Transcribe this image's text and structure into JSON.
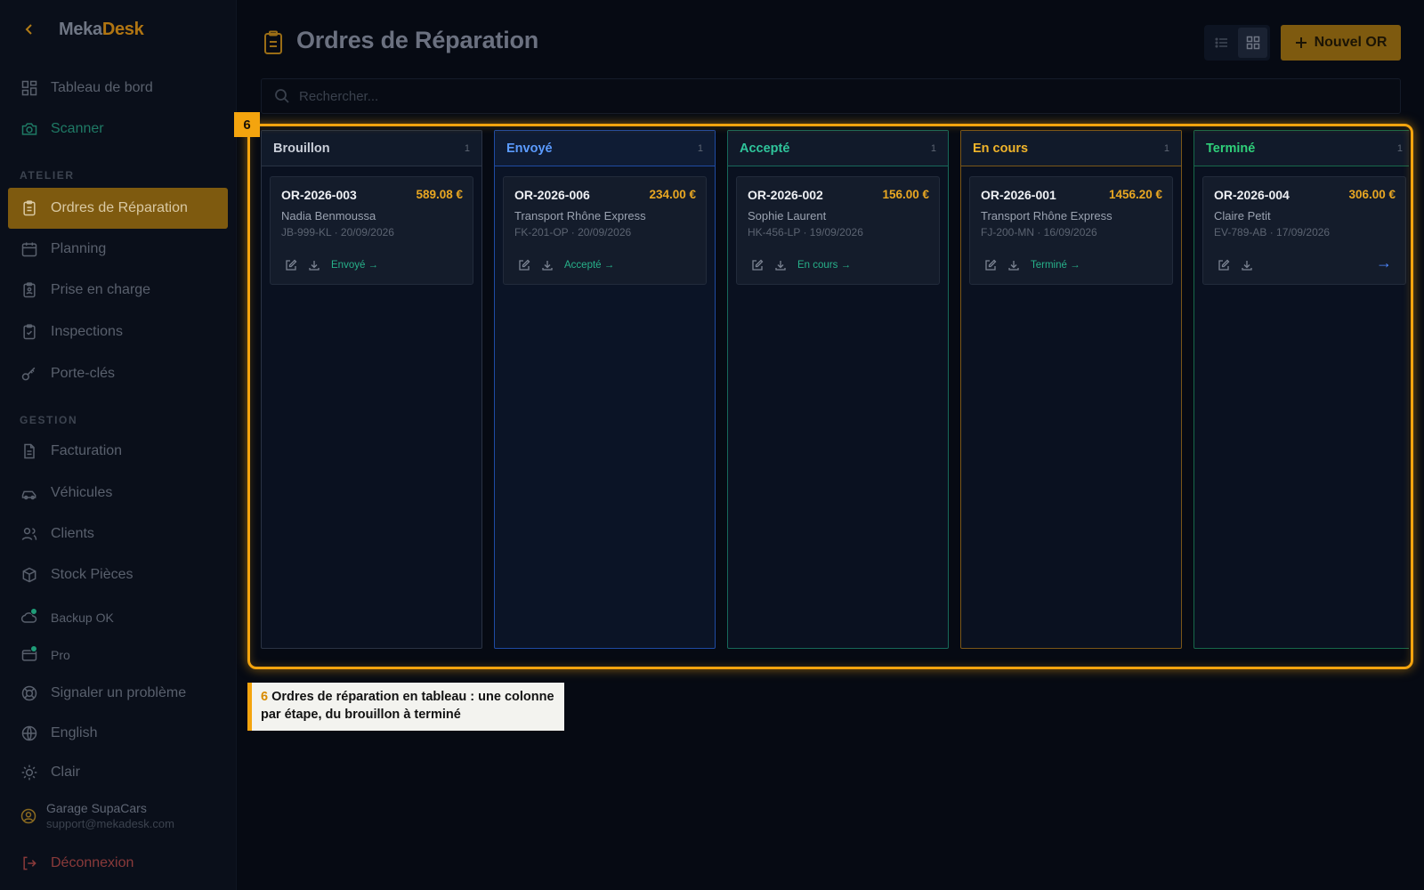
{
  "app": {
    "brand_a": "Meka",
    "brand_b": "Desk",
    "brand_accent": "#b07512"
  },
  "sidebar": {
    "nav": [
      {
        "label": "Tableau de bord",
        "icon": "dashboard-icon"
      },
      {
        "label": "Scanner",
        "icon": "camera-icon"
      }
    ],
    "section_atelier": "ATELIER",
    "atelier": [
      {
        "label": "Ordres de Réparation",
        "icon": "clipboard-icon",
        "active": true
      },
      {
        "label": "Planning",
        "icon": "calendar-icon"
      },
      {
        "label": "Prise en charge",
        "icon": "clipboard-person-icon"
      },
      {
        "label": "Inspections",
        "icon": "clipboard-check-icon"
      },
      {
        "label": "Porte-clés",
        "icon": "key-icon"
      }
    ],
    "section_gestion": "GESTION",
    "gestion": [
      {
        "label": "Facturation",
        "icon": "document-icon"
      },
      {
        "label": "Véhicules",
        "icon": "car-icon"
      },
      {
        "label": "Clients",
        "icon": "users-icon"
      },
      {
        "label": "Stock Pièces",
        "icon": "box-icon"
      }
    ],
    "backup_label": "Backup OK",
    "pro_label": "Pro",
    "report_label": "Signaler un problème",
    "language_label": "English",
    "theme_label": "Clair",
    "user_name": "Garage SupaCars",
    "user_email": "support@mekadesk.com",
    "logout_label": "Déconnexion"
  },
  "header": {
    "title": "Ordres de Réparation",
    "new_button": "Nouvel OR",
    "search_placeholder": "Rechercher..."
  },
  "board": {
    "columns": [
      {
        "title": "Brouillon",
        "count": "1",
        "color": "#c9ced8",
        "border": "#2a3344",
        "card": {
          "id": "OR-2026-003",
          "amount": "589.08 €",
          "client": "Nadia Benmoussa",
          "meta": "JB-999-KL · 20/09/2026",
          "next": "Envoyé →"
        }
      },
      {
        "title": "Envoyé",
        "count": "1",
        "color": "#5b9bff",
        "border": "#1f4ba3",
        "card": {
          "id": "OR-2026-006",
          "amount": "234.00 €",
          "client": "Transport Rhône Express",
          "meta": "FK-201-OP · 20/09/2026",
          "next": "Accepté →"
        }
      },
      {
        "title": "Accepté",
        "count": "1",
        "color": "#2fc59b",
        "border": "#17685a",
        "card": {
          "id": "OR-2026-002",
          "amount": "156.00 €",
          "client": "Sophie Laurent",
          "meta": "HK-456-LP · 19/09/2026",
          "next": "En cours →"
        }
      },
      {
        "title": "En cours",
        "count": "1",
        "color": "#f0b42a",
        "border": "#7a5618",
        "card": {
          "id": "OR-2026-001",
          "amount": "1456.20 €",
          "client": "Transport Rhône Express",
          "meta": "FJ-200-MN · 16/09/2026",
          "next": "Terminé →"
        }
      },
      {
        "title": "Terminé",
        "count": "1",
        "color": "#2fd07a",
        "border": "#17684a",
        "card": {
          "id": "OR-2026-004",
          "amount": "306.00 €",
          "client": "Claire Petit",
          "meta": "EV-789-AB · 17/09/2026",
          "next": "→"
        }
      }
    ]
  },
  "annotation": {
    "number": "6",
    "text": "Ordres de réparation en tableau : une colonne par étape, du brouillon à terminé"
  }
}
